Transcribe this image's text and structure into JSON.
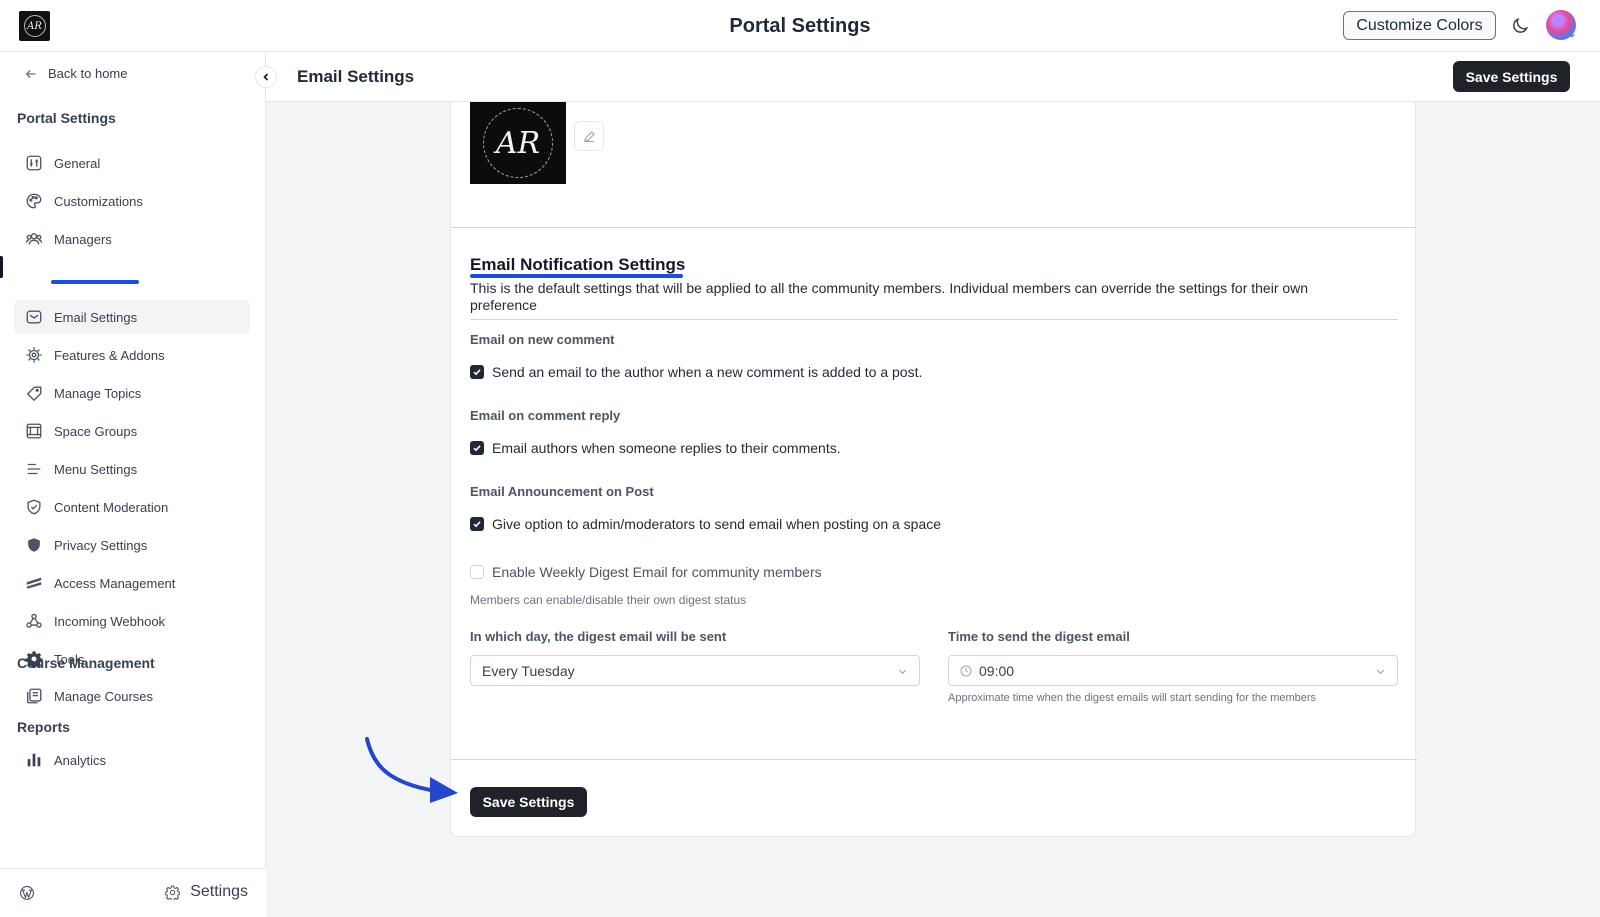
{
  "app": {
    "title": "Portal Settings",
    "logo_text": "AR"
  },
  "topbar": {
    "customize_label": "Customize Colors"
  },
  "sidebar": {
    "back_label": "Back to home",
    "sections": {
      "portal": "Portal Settings",
      "course": "Course Management",
      "reports": "Reports"
    },
    "portal_items": [
      {
        "label": "General",
        "icon": "sliders-icon"
      },
      {
        "label": "Customizations",
        "icon": "palette-icon"
      },
      {
        "label": "Managers",
        "icon": "users-icon"
      },
      {
        "label": "Email Settings",
        "icon": "mail-icon",
        "active": true
      },
      {
        "label": "Features & Addons",
        "icon": "cog-chip-icon"
      },
      {
        "label": "Manage Topics",
        "icon": "tag-icon"
      },
      {
        "label": "Space Groups",
        "icon": "grid-icon"
      },
      {
        "label": "Menu Settings",
        "icon": "menu-icon"
      },
      {
        "label": "Content Moderation",
        "icon": "shield-check-icon"
      },
      {
        "label": "Privacy Settings",
        "icon": "shield-icon"
      },
      {
        "label": "Access Management",
        "icon": "stripes-icon"
      },
      {
        "label": "Incoming Webhook",
        "icon": "webhook-icon"
      },
      {
        "label": "Tools",
        "icon": "gear-icon"
      }
    ],
    "course_items": [
      {
        "label": "Manage Courses",
        "icon": "courses-icon"
      }
    ],
    "report_items": [
      {
        "label": "Analytics",
        "icon": "bar-chart-icon"
      }
    ],
    "footer_settings": "Settings"
  },
  "header": {
    "title": "Email Settings",
    "save_label": "Save Settings"
  },
  "brand": {
    "logo_text": "AR"
  },
  "notifications": {
    "title": "Email Notification Settings",
    "description": "This is the default settings that will be applied to all the community members. Individual members can override the settings for their own preference",
    "new_comment": {
      "label": "Email on new comment",
      "checkbox": "Send an email to the author when a new comment is added to a post.",
      "checked": true
    },
    "comment_reply": {
      "label": "Email on comment reply",
      "checkbox": "Email authors when someone replies to their comments.",
      "checked": true
    },
    "announcement": {
      "label": "Email Announcement on Post",
      "checkbox": "Give option to admin/moderators to send email when posting on a space",
      "checked": true
    },
    "digest": {
      "checkbox": "Enable Weekly Digest Email for community members",
      "checked": false,
      "hint": "Members can enable/disable their own digest status",
      "day_label": "In which day, the digest email will be sent",
      "day_value": "Every Tuesday",
      "time_label": "Time to send the digest email",
      "time_value": "09:00",
      "time_hint": "Approximate time when the digest emails will start sending for the members"
    },
    "save_label": "Save Settings"
  }
}
